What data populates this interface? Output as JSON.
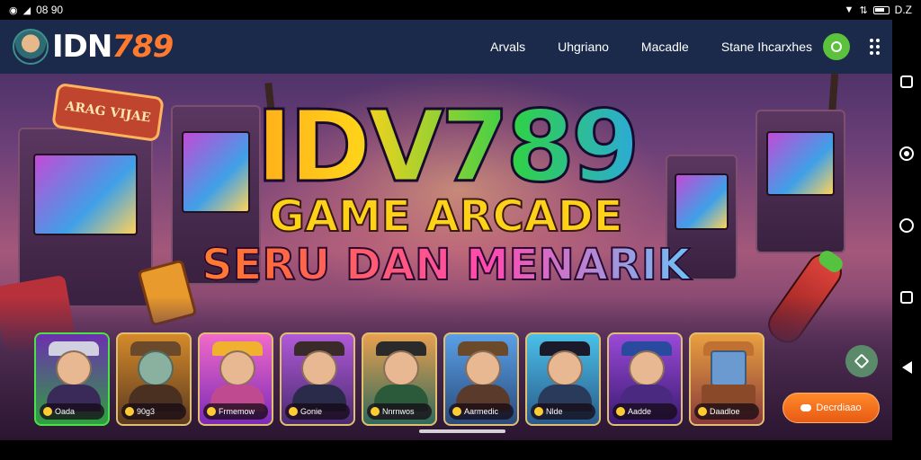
{
  "status_bar": {
    "time": "08 90",
    "right_text": "D.Z"
  },
  "header": {
    "logo_prefix": "IDN",
    "logo_number": "789",
    "nav": [
      {
        "label": "Arvals"
      },
      {
        "label": "Uhgriano"
      },
      {
        "label": "Macadle"
      },
      {
        "label": "Stane Ihcarxhes"
      }
    ]
  },
  "hero": {
    "arcade_sign": "ARAG VIJAE",
    "title": "IDV789",
    "subtitle_1": "GAME ARCADE",
    "subtitle_2": "SERU DAN MENARIK"
  },
  "games": [
    {
      "label": "Oada"
    },
    {
      "label": "90g3"
    },
    {
      "label": "Frmemow"
    },
    {
      "label": "Gonie"
    },
    {
      "label": "Nnrnwos"
    },
    {
      "label": "Aarmedic"
    },
    {
      "label": "Nlde"
    },
    {
      "label": "Aadde"
    },
    {
      "label": "Daadloe"
    }
  ],
  "cta": {
    "label": "Decrdiaao"
  },
  "colors": {
    "header_bg": "#1b2a4a",
    "accent_orange": "#ff7a2e",
    "profile_green": "#5cc23e"
  }
}
